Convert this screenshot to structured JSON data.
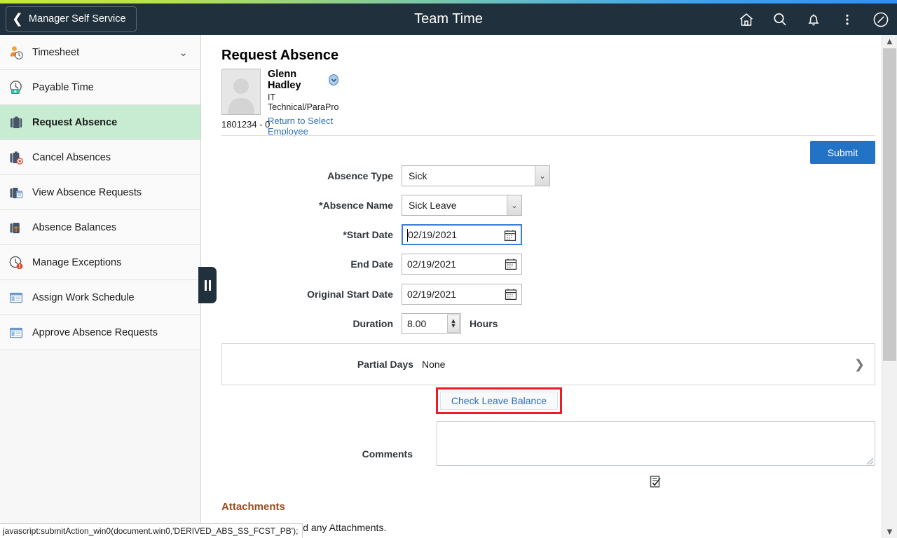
{
  "header": {
    "back_label": "Manager Self Service",
    "back_icon": "chevron-left-icon",
    "title": "Team Time",
    "icons": [
      {
        "name": "home-icon",
        "label": "Home"
      },
      {
        "name": "search-icon",
        "label": "Search"
      },
      {
        "name": "notifications-bell-icon",
        "label": "Notifications"
      },
      {
        "name": "actions-menu-icon",
        "label": "Actions"
      },
      {
        "name": "navbar-compass-icon",
        "label": "NavBar"
      }
    ],
    "accent_colors": [
      "#c6e83b",
      "#2f8ff9"
    ],
    "background": "#21303d"
  },
  "sidebar": {
    "items": [
      {
        "label": "Timesheet",
        "icon": "timesheet-person-clock-icon",
        "selected": false,
        "has_chevron": true
      },
      {
        "label": "Payable Time",
        "icon": "payable-time-clock-icon",
        "selected": false,
        "has_chevron": false
      },
      {
        "label": "Request Absence",
        "icon": "request-absence-briefcase-icon",
        "selected": true,
        "has_chevron": false
      },
      {
        "label": "Cancel Absences",
        "icon": "cancel-absences-briefcase-icon",
        "selected": false,
        "has_chevron": false
      },
      {
        "label": "View Absence Requests",
        "icon": "view-absence-requests-icon",
        "selected": false,
        "has_chevron": false
      },
      {
        "label": "Absence Balances",
        "icon": "absence-balances-icon",
        "selected": false,
        "has_chevron": false
      },
      {
        "label": "Manage Exceptions",
        "icon": "manage-exceptions-alert-clock-icon",
        "selected": false,
        "has_chevron": false
      },
      {
        "label": "Assign Work Schedule",
        "icon": "assign-work-schedule-window-icon",
        "selected": false,
        "has_chevron": false
      },
      {
        "label": "Approve Absence Requests",
        "icon": "approve-absence-requests-window-icon",
        "selected": false,
        "has_chevron": false
      }
    ],
    "selected_background": "#c8ecd2",
    "collapse_handle_icon": "collapse-sidebar-handle-icon"
  },
  "main": {
    "page_title": "Request Absence",
    "employee": {
      "name": "Glenn Hadley",
      "job_title": "IT Technical/ParaPro",
      "return_link": "Return to Select Employee",
      "employee_id": "1801234 - 0",
      "avatar_icon": "employee-photo-placeholder-icon",
      "related_actions_icon": "related-actions-chevron-icon"
    },
    "submit_label": "Submit",
    "submit_color": "#2272c6",
    "form": {
      "absence_type": {
        "label": "Absence Type",
        "value": "Sick"
      },
      "absence_name": {
        "label": "*Absence Name",
        "value": "Sick Leave"
      },
      "start_date": {
        "label": "*Start Date",
        "value": "02/19/2021",
        "focused": true
      },
      "end_date": {
        "label": "End Date",
        "value": "02/19/2021",
        "focused": false
      },
      "original_start_date": {
        "label": "Original Start Date",
        "value": "02/19/2021",
        "focused": false
      },
      "duration": {
        "label": "Duration",
        "value": "8.00",
        "unit": "Hours"
      },
      "partial_days": {
        "label": "Partial Days",
        "value": "None"
      }
    },
    "check_leave_balance": {
      "label": "Check Leave Balance",
      "highlight_color": "#ee1c25"
    },
    "comments": {
      "label": "Comments",
      "value": "",
      "placeholder": ""
    },
    "spellcheck_icon": "spellcheck-icon",
    "attachments": {
      "heading": "Attachments",
      "heading_color": "#9c4c20",
      "note": "You have not added any Attachments."
    }
  },
  "scrollbar": {
    "up_arrow": "scroll-up-arrow-icon",
    "down_arrow": "scroll-down-arrow-icon"
  },
  "status_bar": {
    "text": "javascript:submitAction_win0(document.win0,'DERIVED_ABS_SS_FCST_PB');"
  }
}
